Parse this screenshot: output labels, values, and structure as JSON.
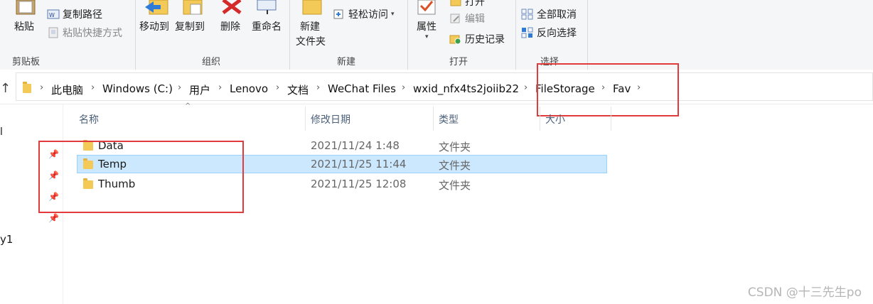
{
  "ribbon": {
    "clipboard": {
      "paste": "粘贴",
      "copy_path": "复制路径",
      "paste_shortcut": "粘贴快捷方式",
      "group": "剪贴板"
    },
    "organize": {
      "move_to": "移动到",
      "copy_to": "复制到",
      "delete": "删除",
      "rename": "重命名",
      "group": "组织"
    },
    "new": {
      "new_folder_line1": "新建",
      "new_folder_line2": "文件夹",
      "easy_access": "轻松访问",
      "group": "新建"
    },
    "open": {
      "properties": "属性",
      "open_top": "打开",
      "edit": "编辑",
      "history": "历史记录",
      "group": "打开"
    },
    "select": {
      "select_none": "全部取消",
      "invert_selection": "反向选择",
      "group": "选择"
    }
  },
  "breadcrumb": [
    "此电脑",
    "Windows (C:)",
    "用户",
    "Lenovo",
    "文档",
    "WeChat Files",
    "wxid_nfx4ts2joiib22",
    "FileStorage",
    "Fav"
  ],
  "columns": {
    "name": "名称",
    "modified": "修改日期",
    "type": "类型",
    "size": "大小"
  },
  "files": [
    {
      "name": "Data",
      "modified": "2021/11/24 1:48",
      "type": "文件夹",
      "selected": false
    },
    {
      "name": "Temp",
      "modified": "2021/11/25 11:44",
      "type": "文件夹",
      "selected": true
    },
    {
      "name": "Thumb",
      "modified": "2021/11/25 12:08",
      "type": "文件夹",
      "selected": false
    }
  ],
  "nav_pane": {
    "fragment_1": "l",
    "fragment_2": "y1"
  },
  "watermark": "CSDN @十三先生po",
  "colors": {
    "selection_bg": "#cce8ff",
    "selection_border": "#99d1ff",
    "highlight_box": "#e23b3b",
    "folder": "#f3c957"
  }
}
